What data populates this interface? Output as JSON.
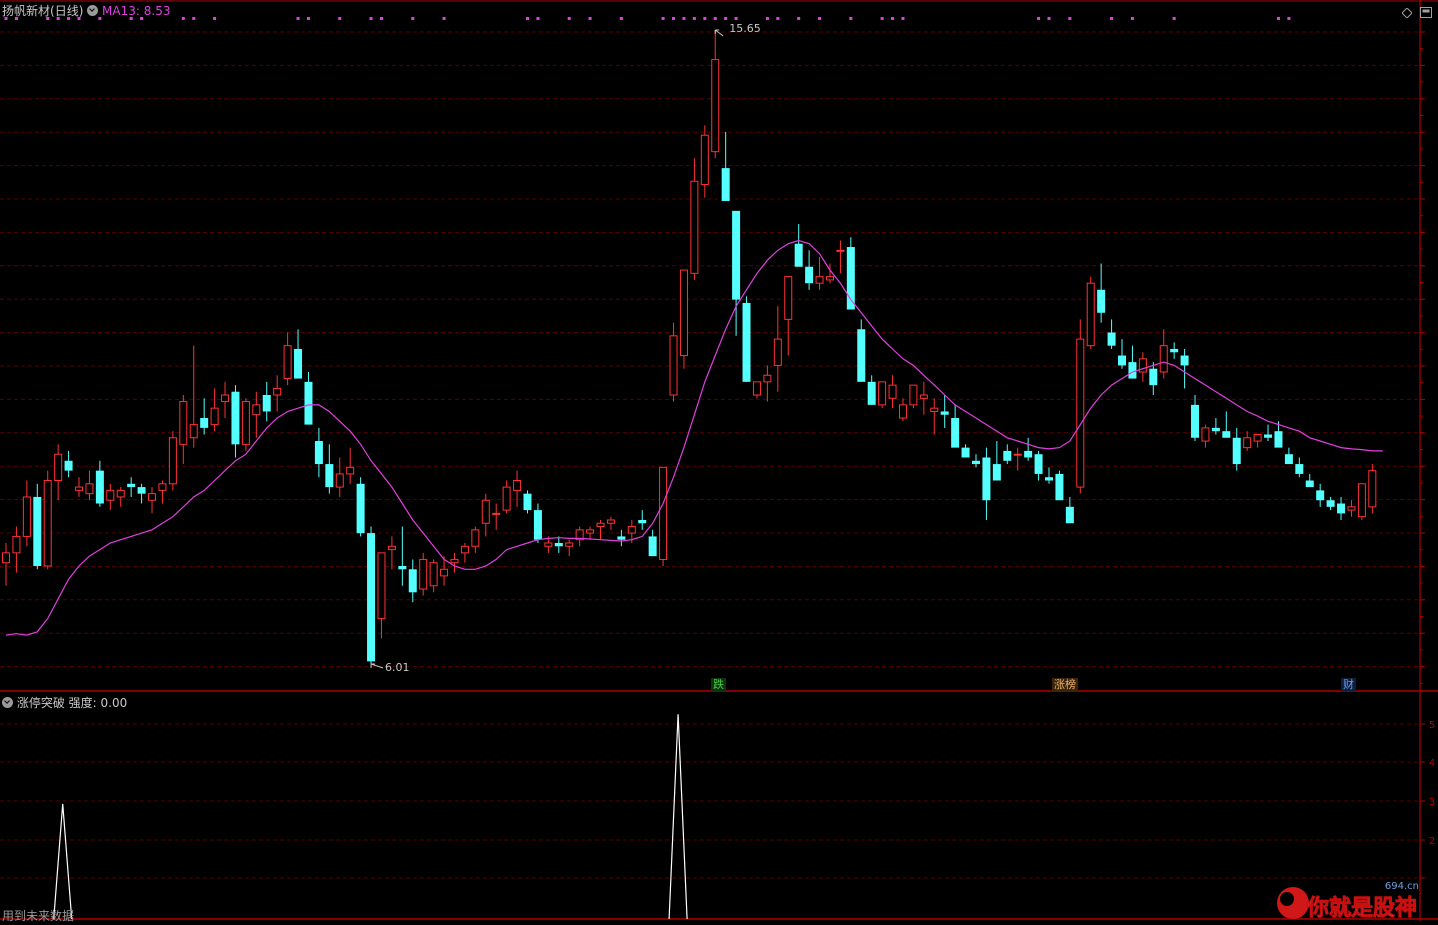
{
  "header": {
    "stock_name": "扬帆新材",
    "period": "(日线)",
    "ma_label": "MA13:",
    "ma_value": "8.53",
    "colors": {
      "name": "#c8c8c8",
      "ma": "#e040e0"
    }
  },
  "indicator": {
    "name": "涨停突破",
    "strength_label": "强度:",
    "strength_value": "0.00",
    "y_ticks": [
      "5",
      "4",
      "3",
      "2"
    ]
  },
  "annotations": {
    "high_label": "15.65",
    "low_label": "6.01",
    "event_tags": [
      {
        "text": "跌",
        "color": "#40d040",
        "bg": "#123012"
      },
      {
        "text": "涨榜",
        "color": "#e8b060",
        "bg": "#3a2410"
      },
      {
        "text": "财",
        "color": "#60a0ff",
        "bg": "#101c3a"
      }
    ]
  },
  "footer": {
    "left_text": "用到未来数据"
  },
  "watermark": {
    "text": "你就是股神",
    "site": "694.cn"
  },
  "toolbar": {
    "diamond_icon": "diamond-icon",
    "window_icon": "window-icon"
  },
  "chart_data": [
    {
      "type": "candlestick",
      "title": "扬帆新材(日线)",
      "price_max": 15.65,
      "price_min": 6.01,
      "up_color": "#ff3232",
      "down_color": "#54ffff",
      "ma_color": "#e040e0",
      "grid": true,
      "candles": [
        [
          7.55,
          7.85,
          7.2,
          7.7
        ],
        [
          7.7,
          8.1,
          7.4,
          7.95
        ],
        [
          7.95,
          8.8,
          7.8,
          8.55
        ],
        [
          8.55,
          8.75,
          7.45,
          7.5
        ],
        [
          7.5,
          8.95,
          7.45,
          8.8
        ],
        [
          8.8,
          9.35,
          8.5,
          9.2
        ],
        [
          9.1,
          9.25,
          8.85,
          8.95
        ],
        [
          8.65,
          8.85,
          8.55,
          8.7
        ],
        [
          8.6,
          8.95,
          8.5,
          8.75
        ],
        [
          8.95,
          9.1,
          8.4,
          8.45
        ],
        [
          8.5,
          8.75,
          8.35,
          8.65
        ],
        [
          8.55,
          8.7,
          8.4,
          8.65
        ],
        [
          8.75,
          8.85,
          8.55,
          8.7
        ],
        [
          8.7,
          8.75,
          8.45,
          8.6
        ],
        [
          8.5,
          8.7,
          8.3,
          8.6
        ],
        [
          8.65,
          8.8,
          8.45,
          8.75
        ],
        [
          8.75,
          9.55,
          8.65,
          9.45
        ],
        [
          9.35,
          10.1,
          9.05,
          10.0
        ],
        [
          9.45,
          10.85,
          9.3,
          9.65
        ],
        [
          9.75,
          10.05,
          9.5,
          9.6
        ],
        [
          9.65,
          10.2,
          9.55,
          9.9
        ],
        [
          10.0,
          10.3,
          9.75,
          10.1
        ],
        [
          10.15,
          10.25,
          9.15,
          9.35
        ],
        [
          9.35,
          10.05,
          9.25,
          10.0
        ],
        [
          9.8,
          10.15,
          9.45,
          9.95
        ],
        [
          10.1,
          10.3,
          9.7,
          9.85
        ],
        [
          10.1,
          10.4,
          9.85,
          10.2
        ],
        [
          10.35,
          11.05,
          10.25,
          10.85
        ],
        [
          10.8,
          11.1,
          10.35,
          10.35
        ],
        [
          10.3,
          10.45,
          9.65,
          9.65
        ],
        [
          9.4,
          9.6,
          8.85,
          9.05
        ],
        [
          9.05,
          9.35,
          8.6,
          8.7
        ],
        [
          8.7,
          9.15,
          8.55,
          8.9
        ],
        [
          8.9,
          9.3,
          8.75,
          9.0
        ],
        [
          8.75,
          8.85,
          7.95,
          8.0
        ],
        [
          8.0,
          8.1,
          6.01,
          6.05
        ],
        [
          6.7,
          7.6,
          6.4,
          7.7
        ],
        [
          7.75,
          7.95,
          7.45,
          7.8
        ],
        [
          7.5,
          8.1,
          7.2,
          7.45
        ],
        [
          7.45,
          7.6,
          6.95,
          7.1
        ],
        [
          7.15,
          7.7,
          7.05,
          7.6
        ],
        [
          7.2,
          7.6,
          7.1,
          7.55
        ],
        [
          7.35,
          7.65,
          7.2,
          7.45
        ],
        [
          7.55,
          7.7,
          7.4,
          7.6
        ],
        [
          7.7,
          7.85,
          7.55,
          7.8
        ],
        [
          7.8,
          8.1,
          7.7,
          8.05
        ],
        [
          8.15,
          8.6,
          7.95,
          8.5
        ],
        [
          8.3,
          8.45,
          8.05,
          8.3
        ],
        [
          8.35,
          8.8,
          8.3,
          8.7
        ],
        [
          8.65,
          8.95,
          8.4,
          8.8
        ],
        [
          8.6,
          8.65,
          8.3,
          8.35
        ],
        [
          8.35,
          8.45,
          7.85,
          7.9
        ],
        [
          7.8,
          7.95,
          7.7,
          7.85
        ],
        [
          7.85,
          7.95,
          7.7,
          7.8
        ],
        [
          7.8,
          7.9,
          7.65,
          7.85
        ],
        [
          7.9,
          8.1,
          7.8,
          8.05
        ],
        [
          8.0,
          8.1,
          7.9,
          8.05
        ],
        [
          8.1,
          8.2,
          7.9,
          8.15
        ],
        [
          8.15,
          8.25,
          8.05,
          8.2
        ],
        [
          7.95,
          8.05,
          7.8,
          7.9
        ],
        [
          8.0,
          8.2,
          7.85,
          8.1
        ],
        [
          8.2,
          8.35,
          8.05,
          8.15
        ],
        [
          7.95,
          8.05,
          7.65,
          7.65
        ],
        [
          7.6,
          9.0,
          7.5,
          9.0
        ],
        [
          10.1,
          11.2,
          10.0,
          11.0
        ],
        [
          10.7,
          11.95,
          10.5,
          12.0
        ],
        [
          11.95,
          13.7,
          11.85,
          13.35
        ],
        [
          13.3,
          14.2,
          13.1,
          14.05
        ],
        [
          13.8,
          15.65,
          13.7,
          15.2
        ],
        [
          13.55,
          14.1,
          13.25,
          13.05
        ],
        [
          12.9,
          11.6,
          11.0,
          11.55
        ],
        [
          11.5,
          11.6,
          10.3,
          10.3
        ],
        [
          10.1,
          10.25,
          10.05,
          10.3
        ],
        [
          10.3,
          10.55,
          10.0,
          10.4
        ],
        [
          10.55,
          11.45,
          10.15,
          10.95
        ],
        [
          11.25,
          11.85,
          10.7,
          11.9
        ],
        [
          12.4,
          12.7,
          12.35,
          12.05
        ],
        [
          12.05,
          12.3,
          11.7,
          11.8
        ],
        [
          11.8,
          12.2,
          11.7,
          11.9
        ],
        [
          11.85,
          12.1,
          11.8,
          11.9
        ],
        [
          12.3,
          12.45,
          11.95,
          12.3
        ],
        [
          12.35,
          12.5,
          11.4,
          11.4
        ],
        [
          11.1,
          11.25,
          10.35,
          10.3
        ],
        [
          10.3,
          10.4,
          9.95,
          9.95
        ],
        [
          9.95,
          10.25,
          9.9,
          10.3
        ],
        [
          10.05,
          10.4,
          9.9,
          10.25
        ],
        [
          9.75,
          10.05,
          9.7,
          9.95
        ],
        [
          9.95,
          10.25,
          9.9,
          10.25
        ],
        [
          10.05,
          10.3,
          9.8,
          10.1
        ],
        [
          9.85,
          10.05,
          9.5,
          9.9
        ],
        [
          9.85,
          10.1,
          9.6,
          9.8
        ],
        [
          9.75,
          9.95,
          9.45,
          9.3
        ],
        [
          9.3,
          9.35,
          9.2,
          9.15
        ],
        [
          9.1,
          9.2,
          9.0,
          9.05
        ],
        [
          9.15,
          9.3,
          8.2,
          8.5
        ],
        [
          9.05,
          9.4,
          8.8,
          8.8
        ],
        [
          9.25,
          9.35,
          9.05,
          9.1
        ],
        [
          9.2,
          9.3,
          8.95,
          9.2
        ],
        [
          9.25,
          9.45,
          9.1,
          9.15
        ],
        [
          9.2,
          9.25,
          8.8,
          8.9
        ],
        [
          8.85,
          9.0,
          8.75,
          8.8
        ],
        [
          8.9,
          8.95,
          8.55,
          8.5
        ],
        [
          8.4,
          8.55,
          8.2,
          8.15
        ],
        [
          8.7,
          11.25,
          8.6,
          10.95
        ],
        [
          10.85,
          11.9,
          10.8,
          11.8
        ],
        [
          11.7,
          12.1,
          11.2,
          11.35
        ],
        [
          11.05,
          11.25,
          10.8,
          10.85
        ],
        [
          10.7,
          10.95,
          10.5,
          10.55
        ],
        [
          10.6,
          10.85,
          10.35,
          10.35
        ],
        [
          10.45,
          10.75,
          10.3,
          10.65
        ],
        [
          10.5,
          10.6,
          10.1,
          10.25
        ],
        [
          10.45,
          11.1,
          10.35,
          10.85
        ],
        [
          10.8,
          10.9,
          10.65,
          10.75
        ],
        [
          10.7,
          10.8,
          10.2,
          10.55
        ],
        [
          9.95,
          10.1,
          9.4,
          9.45
        ],
        [
          9.4,
          9.65,
          9.3,
          9.6
        ],
        [
          9.6,
          9.75,
          9.5,
          9.55
        ],
        [
          9.55,
          9.85,
          9.45,
          9.45
        ],
        [
          9.45,
          9.6,
          8.95,
          9.05
        ],
        [
          9.3,
          9.55,
          9.25,
          9.45
        ],
        [
          9.4,
          9.5,
          9.3,
          9.5
        ],
        [
          9.5,
          9.65,
          9.4,
          9.45
        ],
        [
          9.55,
          9.7,
          9.35,
          9.3
        ],
        [
          9.2,
          9.3,
          9.05,
          9.05
        ],
        [
          9.05,
          9.15,
          8.85,
          8.9
        ],
        [
          8.8,
          8.9,
          8.75,
          8.7
        ],
        [
          8.65,
          8.75,
          8.4,
          8.5
        ],
        [
          8.5,
          8.55,
          8.35,
          8.4
        ],
        [
          8.45,
          8.55,
          8.2,
          8.3
        ],
        [
          8.35,
          8.5,
          8.25,
          8.4
        ],
        [
          8.25,
          8.75,
          8.2,
          8.75
        ],
        [
          8.4,
          9.05,
          8.3,
          8.95
        ]
      ],
      "ma13": [
        6.45,
        6.47,
        6.45,
        6.5,
        6.7,
        7.0,
        7.3,
        7.5,
        7.65,
        7.75,
        7.85,
        7.9,
        7.95,
        8.0,
        8.05,
        8.15,
        8.25,
        8.4,
        8.55,
        8.65,
        8.8,
        8.95,
        9.1,
        9.2,
        9.4,
        9.6,
        9.75,
        9.85,
        9.9,
        9.95,
        9.95,
        9.85,
        9.7,
        9.55,
        9.35,
        9.1,
        8.9,
        8.7,
        8.45,
        8.2,
        8.0,
        7.8,
        7.6,
        7.5,
        7.45,
        7.45,
        7.5,
        7.6,
        7.75,
        7.8,
        7.85,
        7.9,
        7.92,
        7.93,
        7.92,
        7.92,
        7.91,
        7.9,
        7.89,
        7.88,
        7.9,
        7.95,
        8.15,
        8.45,
        8.85,
        9.3,
        9.8,
        10.3,
        10.7,
        11.1,
        11.45,
        11.7,
        11.95,
        12.15,
        12.3,
        12.4,
        12.45,
        12.4,
        12.25,
        12.0,
        11.8,
        11.55,
        11.35,
        11.15,
        10.95,
        10.8,
        10.65,
        10.55,
        10.4,
        10.25,
        10.1,
        9.95,
        9.85,
        9.75,
        9.65,
        9.55,
        9.45,
        9.4,
        9.35,
        9.3,
        9.28,
        9.3,
        9.4,
        9.65,
        9.9,
        10.1,
        10.25,
        10.35,
        10.45,
        10.5,
        10.55,
        10.6,
        10.55,
        10.45,
        10.35,
        10.25,
        10.15,
        10.05,
        9.95,
        9.85,
        9.78,
        9.7,
        9.65,
        9.6,
        9.55,
        9.45,
        9.4,
        9.35,
        9.3,
        9.28,
        9.27,
        9.25,
        9.25
      ]
    },
    {
      "type": "line",
      "title": "涨停突破 强度",
      "y_ticks": [
        "5",
        "4",
        "3",
        "2"
      ],
      "color": "#ffffff",
      "spikes": [
        {
          "bar": 4,
          "value": 2.95
        },
        {
          "bar": 63,
          "value": 5.25
        }
      ]
    }
  ]
}
